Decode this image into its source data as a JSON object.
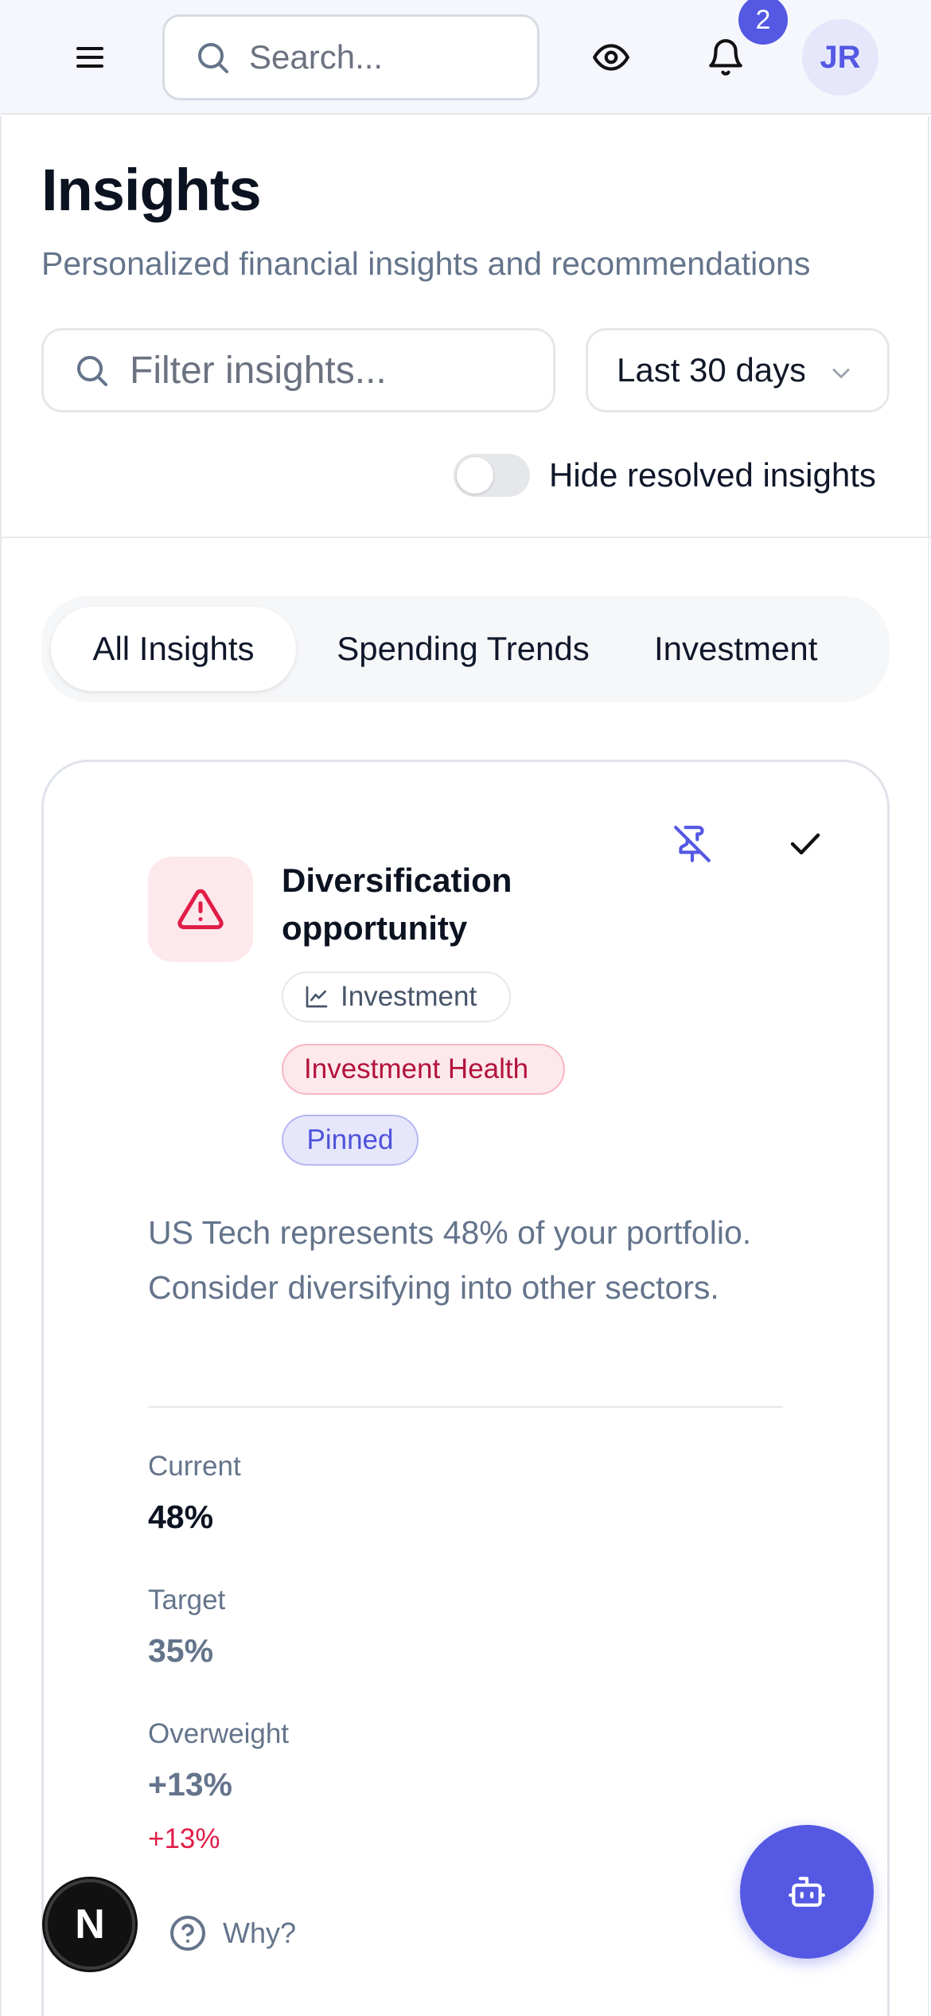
{
  "header": {
    "search_placeholder": "Search...",
    "notification_count": "2",
    "avatar_initials": "JR"
  },
  "page": {
    "title": "Insights",
    "subtitle": "Personalized financial insights and recommendations",
    "filter_placeholder": "Filter insights...",
    "date_range": "Last 30 days",
    "toggle_label": "Hide resolved insights"
  },
  "tabs": [
    {
      "label": "All Insights",
      "active": true
    },
    {
      "label": "Spending Trends",
      "active": false
    },
    {
      "label": "Investment",
      "active": false
    }
  ],
  "insight": {
    "title": "Diversification opportunity",
    "category": "Investment",
    "tag": "Investment Health",
    "status": "Pinned",
    "description": "US Tech represents 48% of your portfolio. Consider diversifying into other sectors.",
    "metrics": [
      {
        "label": "Current",
        "value": "48%"
      },
      {
        "label": "Target",
        "value": "35%"
      },
      {
        "label": "Overweight",
        "value": "+13%",
        "delta": "+13%"
      }
    ],
    "why_label": "Why?"
  },
  "floating": {
    "n_badge": "N"
  },
  "colors": {
    "accent": "#5458e3",
    "alert": "#e11d48",
    "alert_bg": "#fde8ec"
  }
}
